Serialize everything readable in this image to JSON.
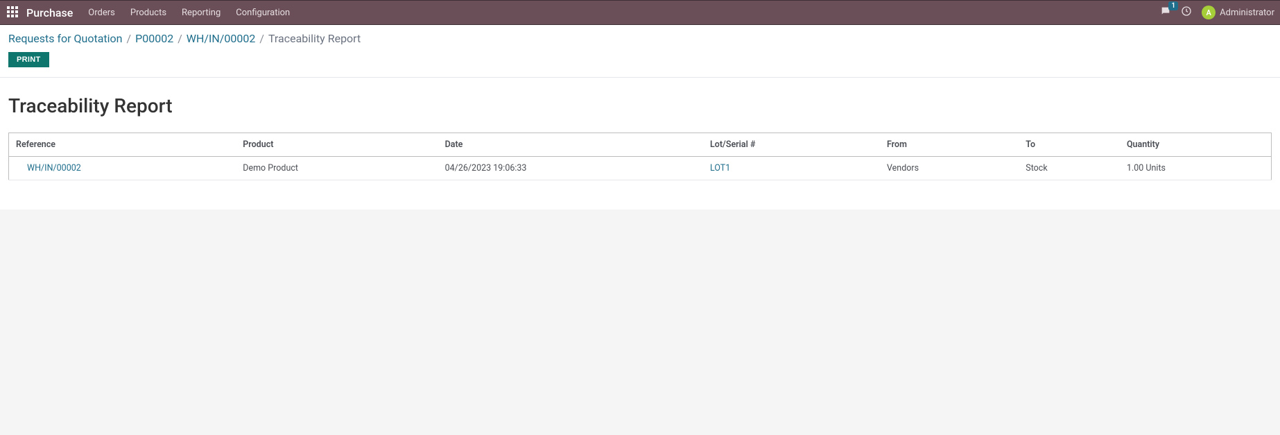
{
  "topbar": {
    "brand": "Purchase",
    "nav": [
      "Orders",
      "Products",
      "Reporting",
      "Configuration"
    ],
    "chat_badge": "1",
    "user": {
      "initial": "A",
      "name": "Administrator"
    }
  },
  "breadcrumb": {
    "items": [
      {
        "label": "Requests for Quotation",
        "link": true
      },
      {
        "label": "P00002",
        "link": true
      },
      {
        "label": "WH/IN/00002",
        "link": true
      },
      {
        "label": "Traceability Report",
        "link": false
      }
    ]
  },
  "buttons": {
    "print": "PRINT"
  },
  "report": {
    "title": "Traceability Report",
    "columns": {
      "reference": "Reference",
      "product": "Product",
      "date": "Date",
      "lot": "Lot/Serial #",
      "from": "From",
      "to": "To",
      "quantity": "Quantity"
    },
    "rows": [
      {
        "reference": "WH/IN/00002",
        "product": "Demo Product",
        "date": "04/26/2023 19:06:33",
        "lot": "LOT1",
        "from": "Vendors",
        "to": "Stock",
        "quantity": "1.00 Units"
      }
    ]
  }
}
